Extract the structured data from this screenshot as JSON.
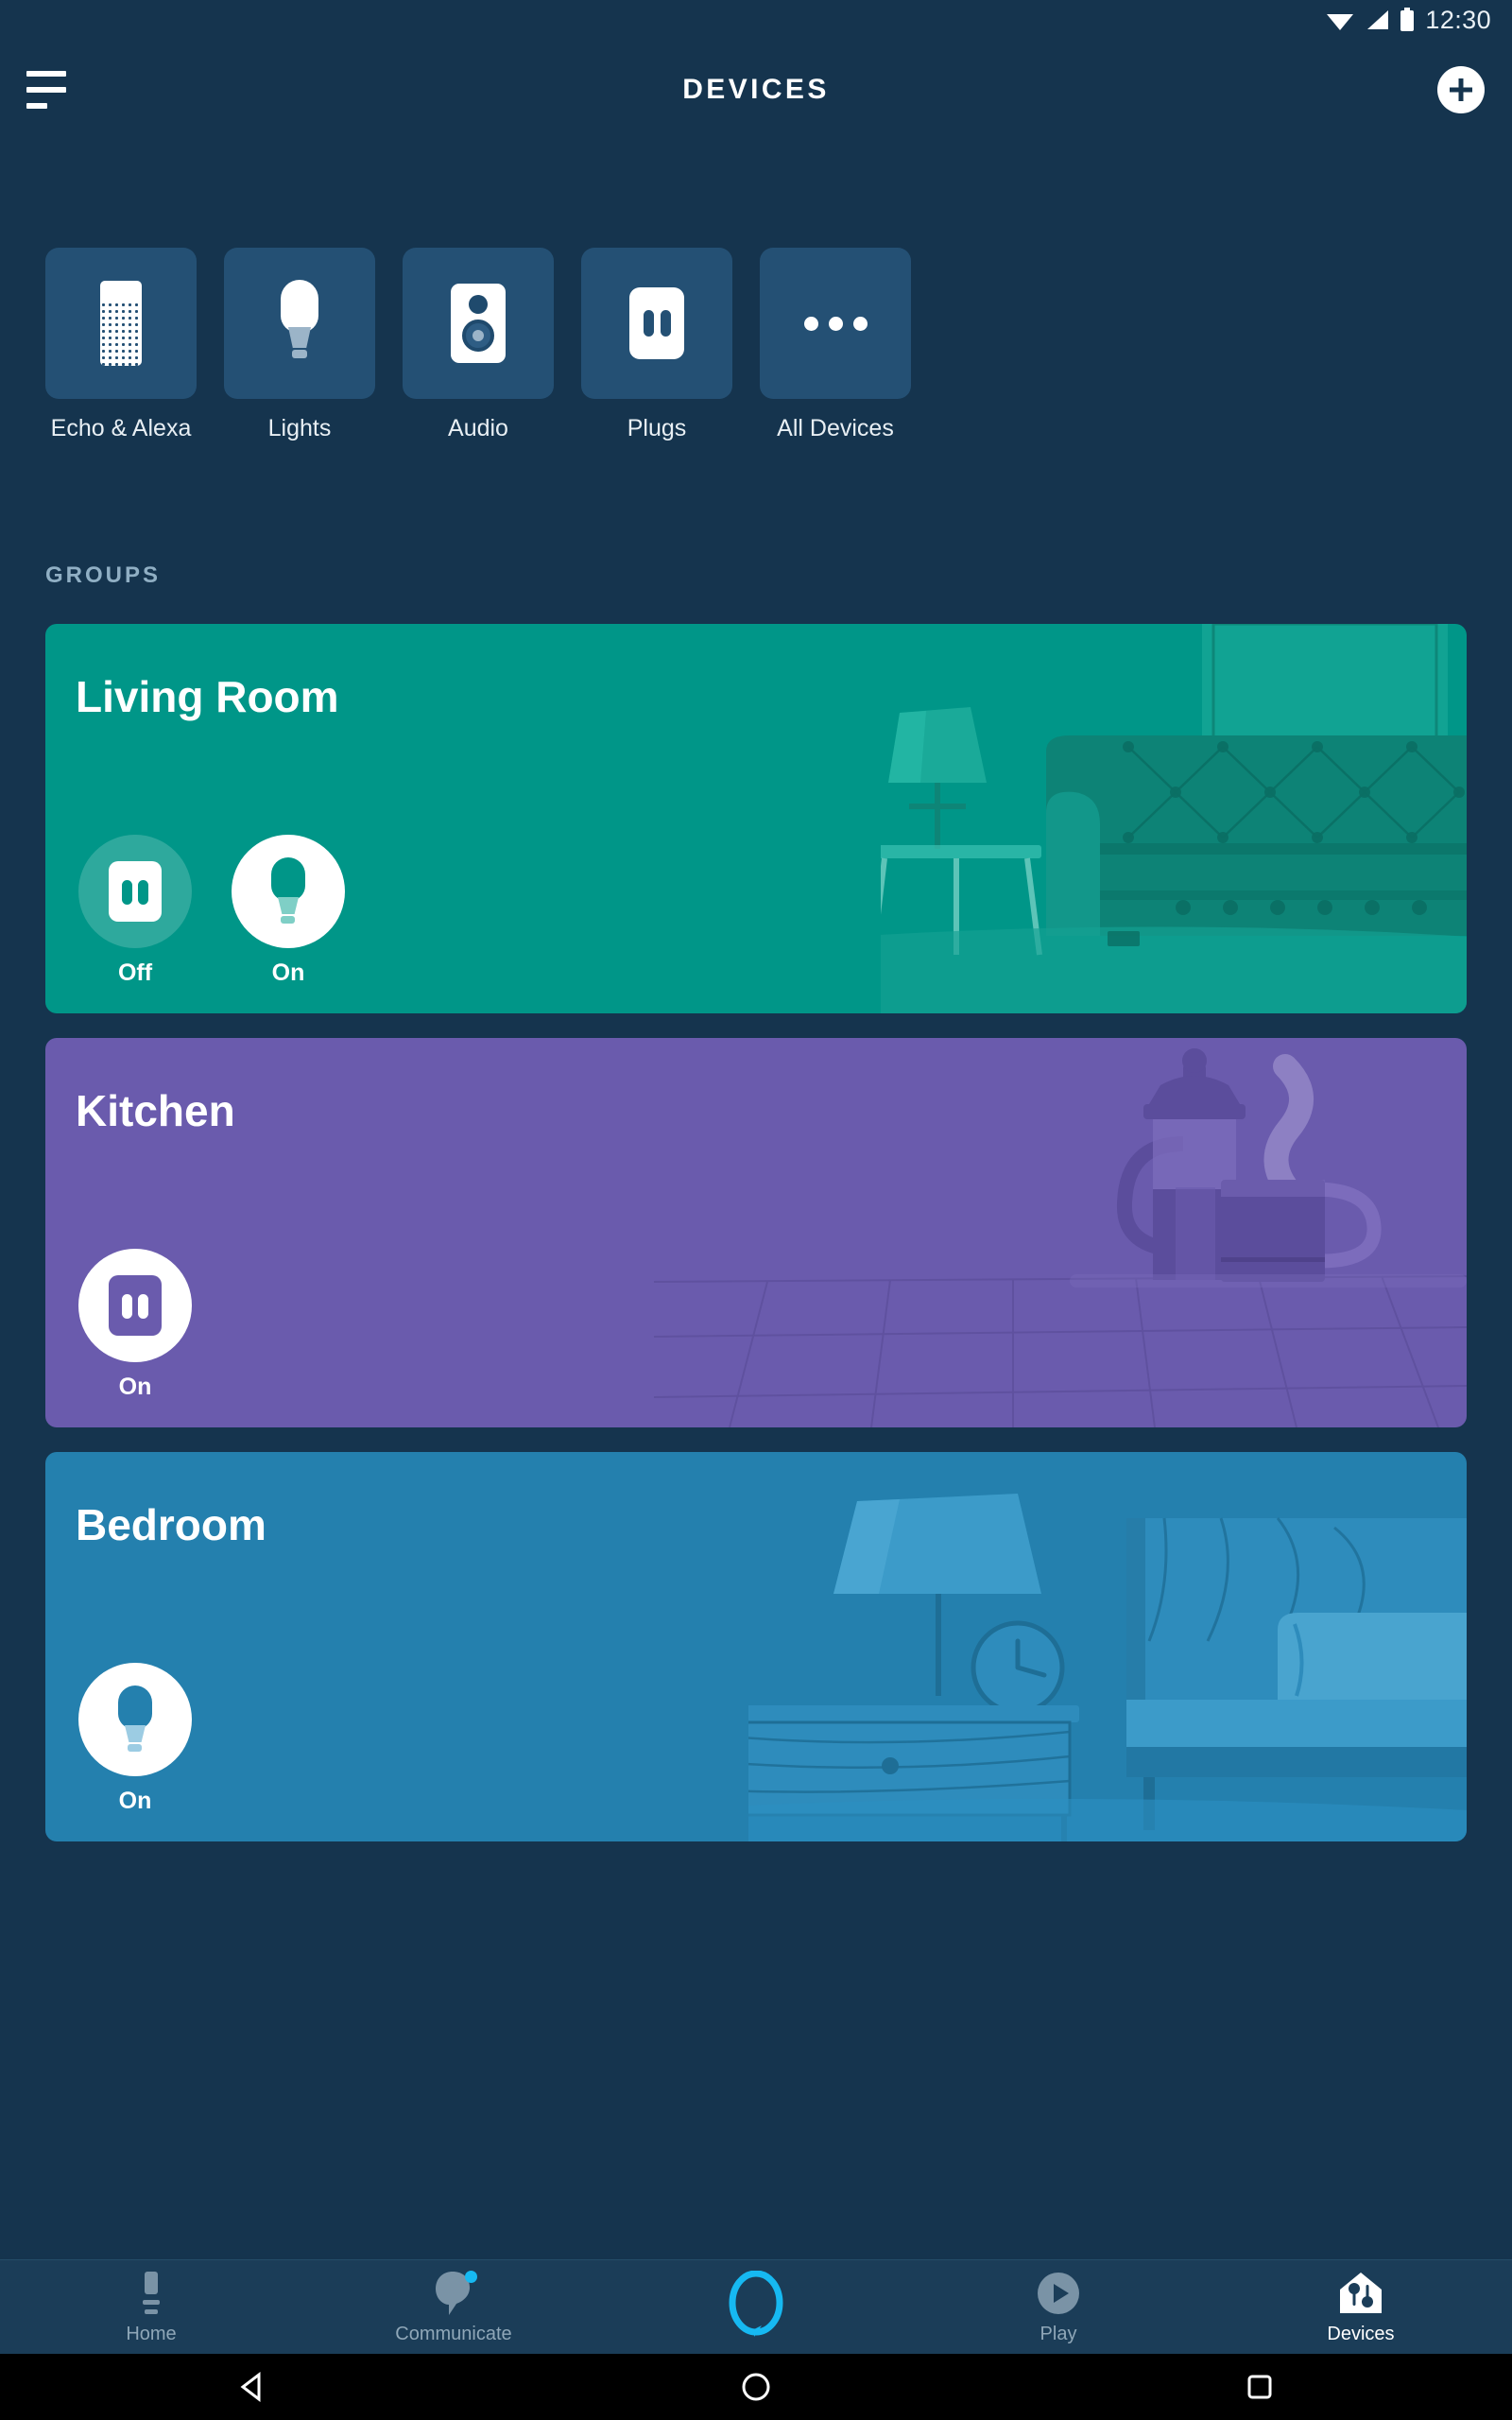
{
  "status_bar": {
    "time": "12:30",
    "icons": [
      "wifi-icon",
      "cellular-signal-icon",
      "battery-icon"
    ]
  },
  "app_bar": {
    "menu_icon": "hamburger-menu-icon",
    "title": "DEVICES",
    "add_icon": "add-circle-icon"
  },
  "categories": [
    {
      "label": "Echo & Alexa",
      "icon": "echo-speaker-icon"
    },
    {
      "label": "Lights",
      "icon": "light-bulb-icon"
    },
    {
      "label": "Audio",
      "icon": "audio-speaker-icon"
    },
    {
      "label": "Plugs",
      "icon": "power-plug-icon"
    },
    {
      "label": "All Devices",
      "icon": "ellipsis-icon"
    }
  ],
  "groups": {
    "section_label": "GROUPS",
    "cards": [
      {
        "name": "Living Room",
        "color": "#009688",
        "art": "living-room-illustration",
        "toggles": [
          {
            "type": "plug",
            "state": "Off",
            "on": false
          },
          {
            "type": "light",
            "state": "On",
            "on": true
          }
        ]
      },
      {
        "name": "Kitchen",
        "color": "#6A5BAD",
        "art": "kitchen-illustration",
        "toggles": [
          {
            "type": "plug",
            "state": "On",
            "on": true
          }
        ]
      },
      {
        "name": "Bedroom",
        "color": "#2480AE",
        "art": "bedroom-illustration",
        "toggles": [
          {
            "type": "light",
            "state": "On",
            "on": true
          }
        ]
      }
    ]
  },
  "bottom_nav": [
    {
      "label": "Home",
      "icon": "home-echo-icon",
      "active": false,
      "badge": false
    },
    {
      "label": "Communicate",
      "icon": "communicate-bubble-icon",
      "active": false,
      "badge": true
    },
    {
      "label": "",
      "icon": "alexa-ring-icon",
      "active": false,
      "badge": false
    },
    {
      "label": "Play",
      "icon": "play-circle-icon",
      "active": false,
      "badge": false
    },
    {
      "label": "Devices",
      "icon": "devices-house-icon",
      "active": true,
      "badge": false
    }
  ],
  "system_nav": [
    {
      "icon": "back-triangle-icon"
    },
    {
      "icon": "home-circle-icon"
    },
    {
      "icon": "recents-square-icon"
    }
  ],
  "theme": {
    "background": "#15344E",
    "tile_background": "#245074",
    "nav_background": "#1B3D58",
    "accent_cyan": "#16B9F2",
    "text_primary": "#FFFFFF",
    "text_muted": "#90AFC4"
  }
}
